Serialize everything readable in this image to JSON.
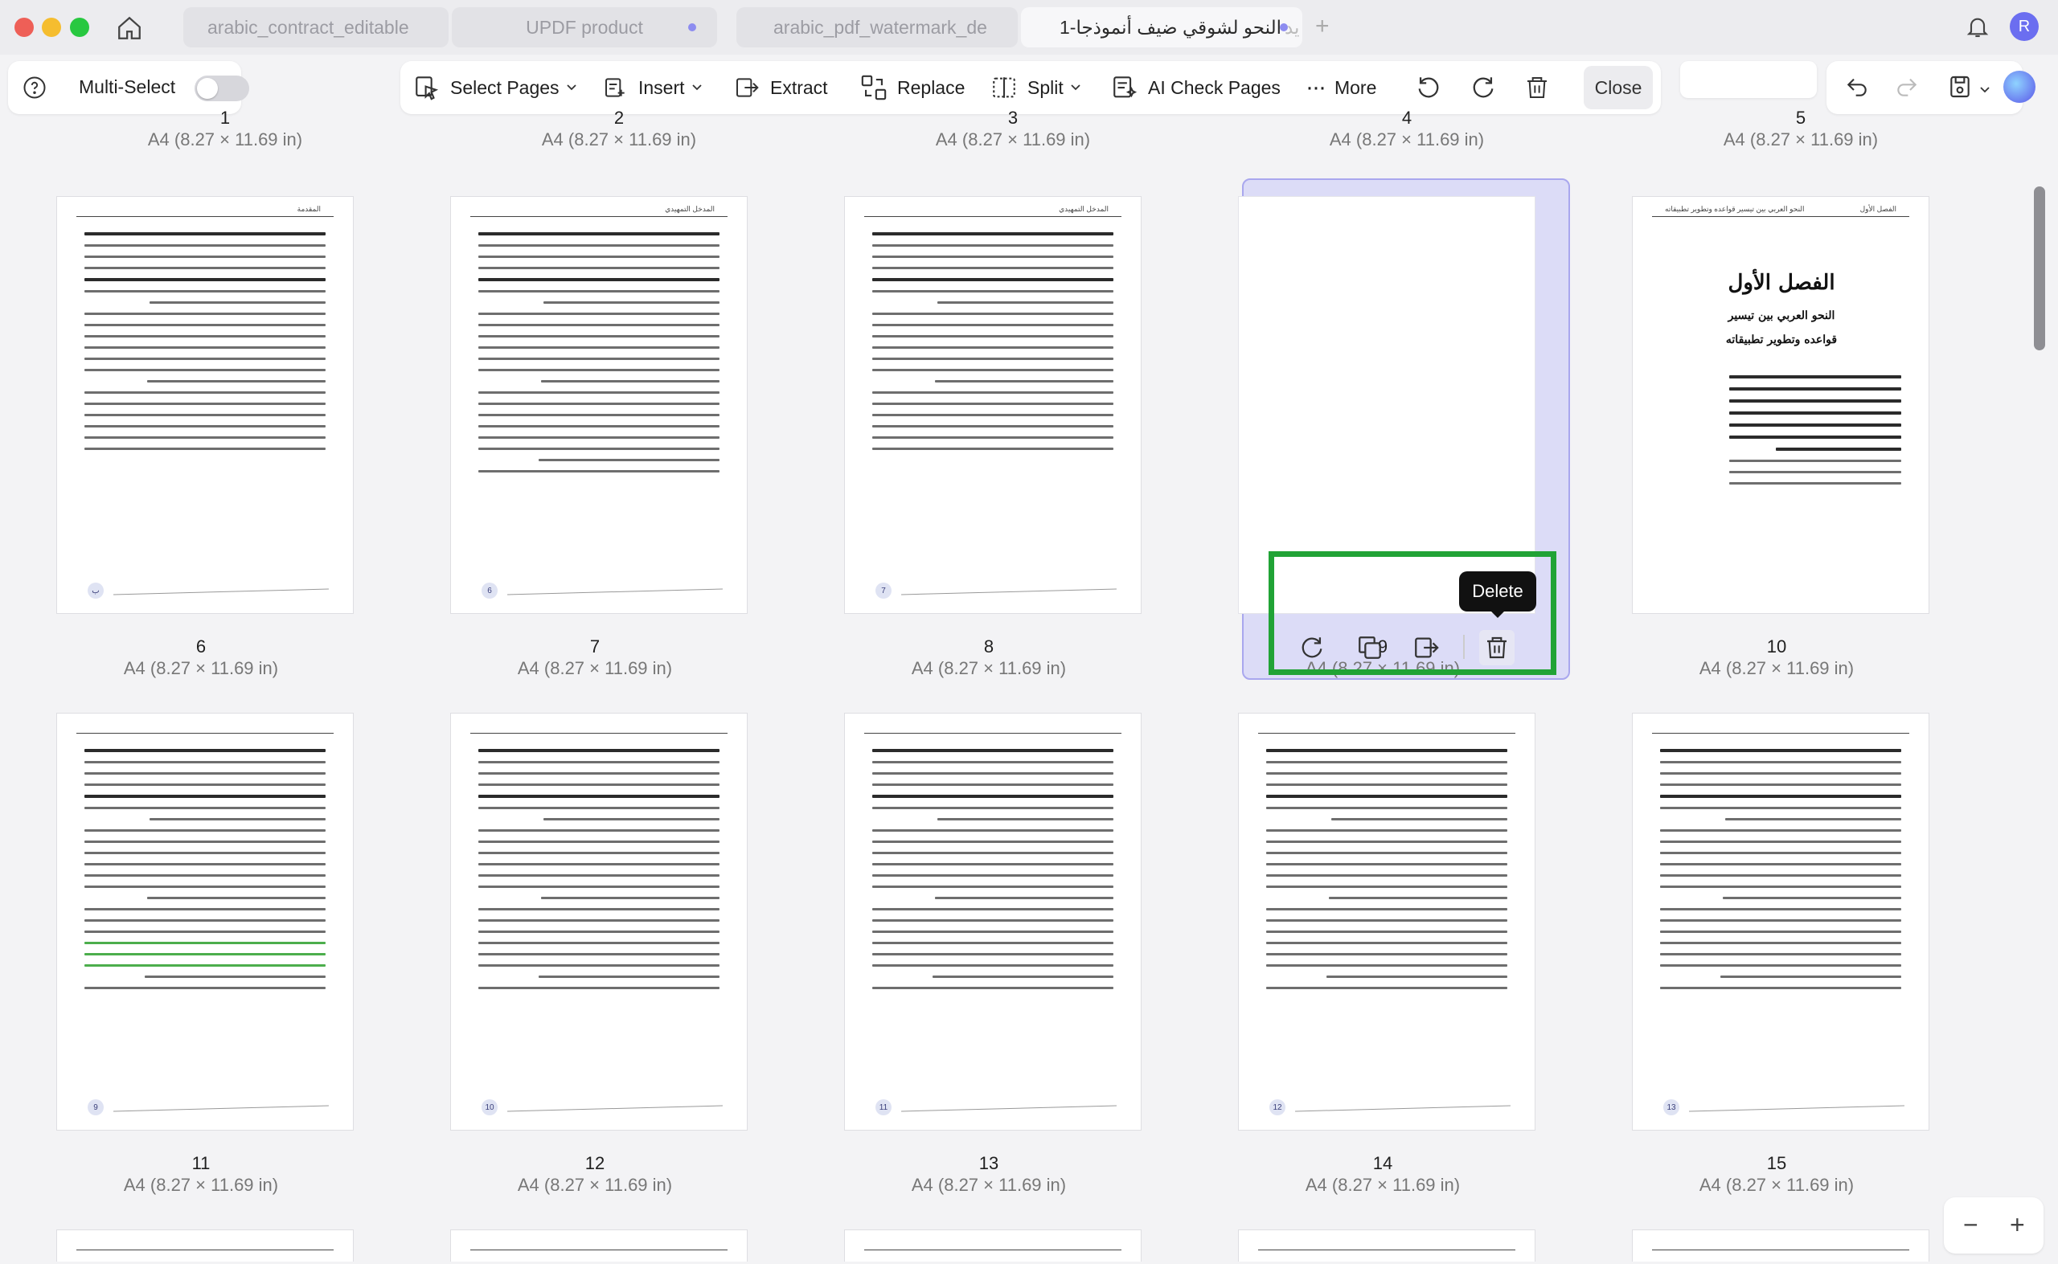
{
  "tabs": [
    {
      "label": "arabic_contract_editable",
      "active": false,
      "dot": false
    },
    {
      "label": "UPDF product",
      "active": false,
      "dot": true
    },
    {
      "label": "arabic_pdf_watermark_de",
      "active": false,
      "dot": false
    },
    {
      "label": "النحو لشوقي ضيف أنموذجا-1",
      "label_prefix": "يد",
      "active": true,
      "dot": true
    }
  ],
  "toolbar": {
    "multi_select_label": "Multi-Select",
    "multi_select_on": false,
    "select_pages": "Select Pages",
    "insert": "Insert",
    "extract": "Extract",
    "replace": "Replace",
    "split": "Split",
    "ai_check": "AI Check Pages",
    "more": "More",
    "close": "Close"
  },
  "top_row": [
    {
      "num": "1",
      "size": "A4 (8.27 × 11.69 in)"
    },
    {
      "num": "2",
      "size": "A4 (8.27 × 11.69 in)"
    },
    {
      "num": "3",
      "size": "A4 (8.27 × 11.69 in)"
    },
    {
      "num": "4",
      "size": "A4 (8.27 × 11.69 in)"
    },
    {
      "num": "5",
      "size": "A4 (8.27 × 11.69 in)"
    }
  ],
  "pages": [
    {
      "num": "6",
      "size": "A4 (8.27 × 11.69 in)",
      "header_right": "المقدمة",
      "footnum": "ب"
    },
    {
      "num": "7",
      "size": "A4 (8.27 × 11.69 in)",
      "header_right": "المدخل التمهيدي",
      "footnum": "6"
    },
    {
      "num": "8",
      "size": "A4 (8.27 × 11.69 in)",
      "header_right": "المدخل التمهيدي",
      "footnum": "7"
    },
    {
      "num": "9",
      "size": "A4 (8.27 × 11.69 in)",
      "selected": true
    },
    {
      "num": "10",
      "size": "A4 (8.27 × 11.69 in)",
      "header_left": "النحو العربي بين تيسير قواعده وتطوير تطبيقاته",
      "header_right": "الفصل الأول",
      "chapter_title": "الفصل الأول",
      "subtitle_1": "النحو العربي بين تيسير",
      "subtitle_2": "قواعده وتطوير تطبيقاته"
    },
    {
      "num": "11",
      "size": "A4 (8.27 × 11.69 in)",
      "footnum": "9"
    },
    {
      "num": "12",
      "size": "A4 (8.27 × 11.69 in)",
      "footnum": "10"
    },
    {
      "num": "13",
      "size": "A4 (8.27 × 11.69 in)",
      "footnum": "11"
    },
    {
      "num": "14",
      "size": "A4 (8.27 × 11.69 in)",
      "footnum": "12"
    },
    {
      "num": "15",
      "size": "A4 (8.27 × 11.69 in)",
      "footnum": "13"
    }
  ],
  "page_actions": {
    "tooltip": "Delete",
    "icons": [
      "rotate-icon",
      "duplicate-icon",
      "extract-page-icon",
      "trash-icon"
    ]
  },
  "zoom": {
    "minus": "−",
    "plus": "+"
  },
  "avatar_initial": "R",
  "colors": {
    "accent": "#7b78f0",
    "delete_highlight": "#21a336",
    "selection": "#dcdcf7"
  }
}
